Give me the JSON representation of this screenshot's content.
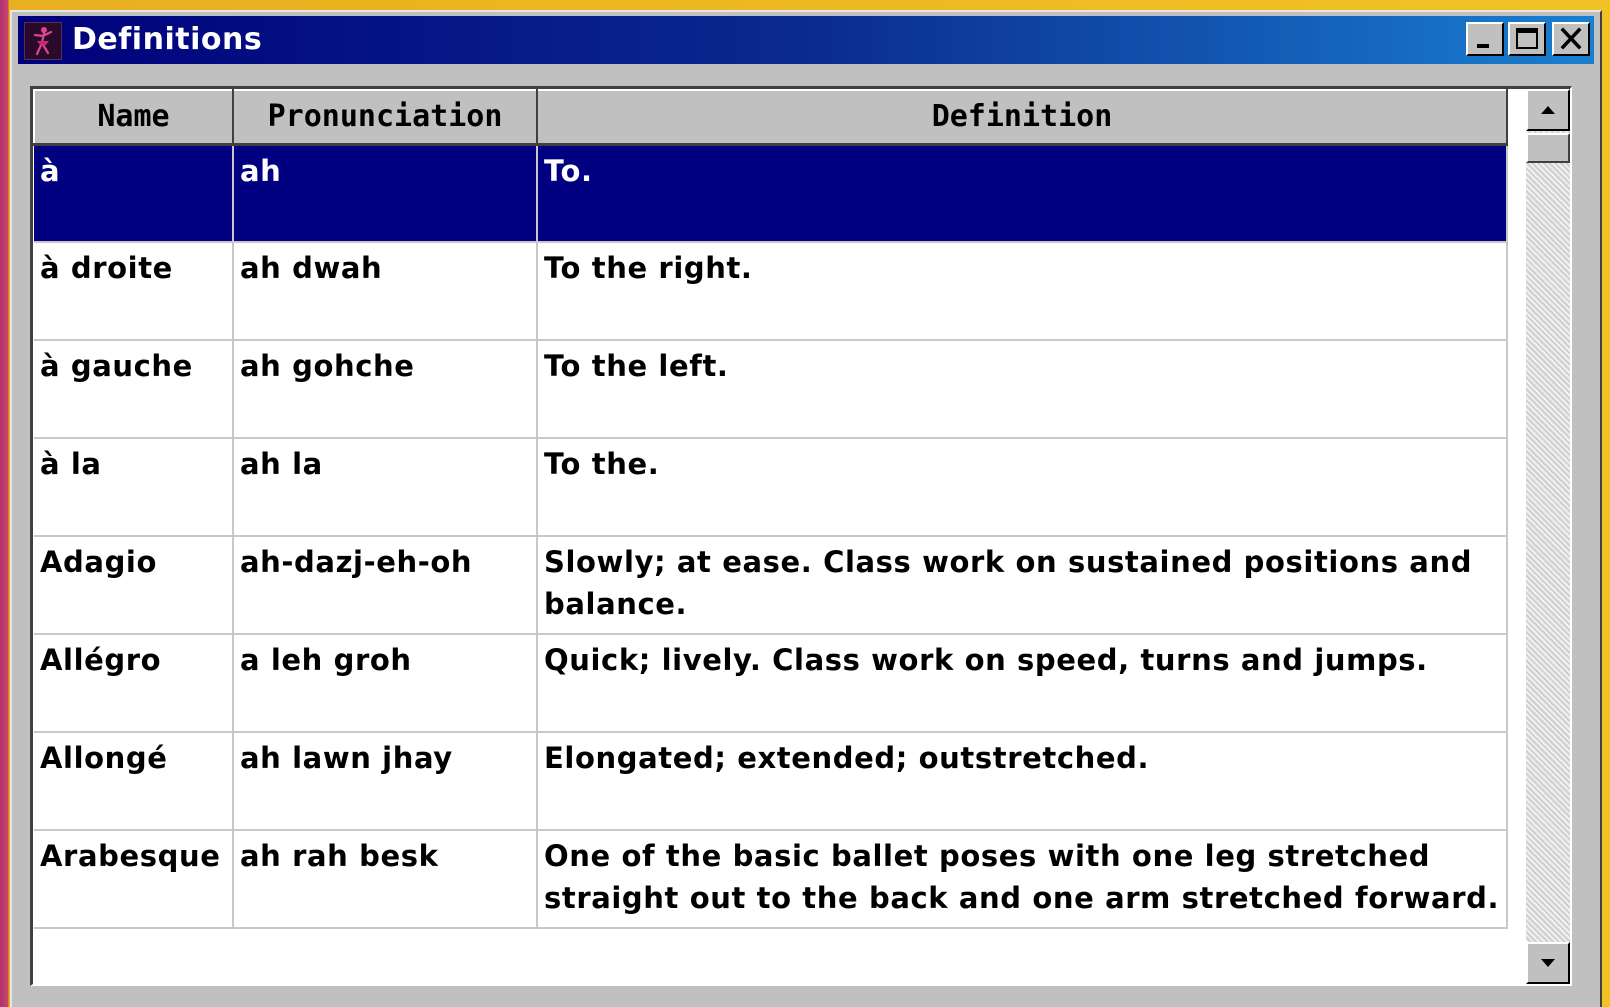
{
  "window": {
    "title": "Definitions",
    "icon": "ballet-dancer-icon"
  },
  "table": {
    "headers": [
      "Name",
      "Pronunciation",
      "Definition"
    ],
    "rows": [
      {
        "name": "à",
        "pronunciation": "ah",
        "definition": "To.",
        "selected": true
      },
      {
        "name": "à droite",
        "pronunciation": "ah dwah",
        "definition": "To the right.",
        "selected": false
      },
      {
        "name": "à gauche",
        "pronunciation": "ah gohche",
        "definition": "To the left.",
        "selected": false
      },
      {
        "name": "à la",
        "pronunciation": "ah la",
        "definition": "To the.",
        "selected": false
      },
      {
        "name": "Adagio",
        "pronunciation": "ah-dazj-eh-oh",
        "definition": "Slowly; at ease. Class work on sustained positions and balance.",
        "selected": false
      },
      {
        "name": "Allégro",
        "pronunciation": "a leh groh",
        "definition": "Quick; lively. Class work on speed, turns and jumps.",
        "selected": false
      },
      {
        "name": "Allongé",
        "pronunciation": "ah lawn jhay",
        "definition": "Elongated; extended; outstretched.",
        "selected": false
      },
      {
        "name": "Arabesque",
        "pronunciation": "ah rah besk",
        "definition": "One of  the basic ballet poses with one leg stretched straight out to the back and one arm stretched forward.",
        "selected": false
      }
    ]
  },
  "colors": {
    "selection": "#000080",
    "titlebar_start": "#00007b",
    "titlebar_end": "#1a7fd0",
    "face": "#c0c0c0"
  }
}
